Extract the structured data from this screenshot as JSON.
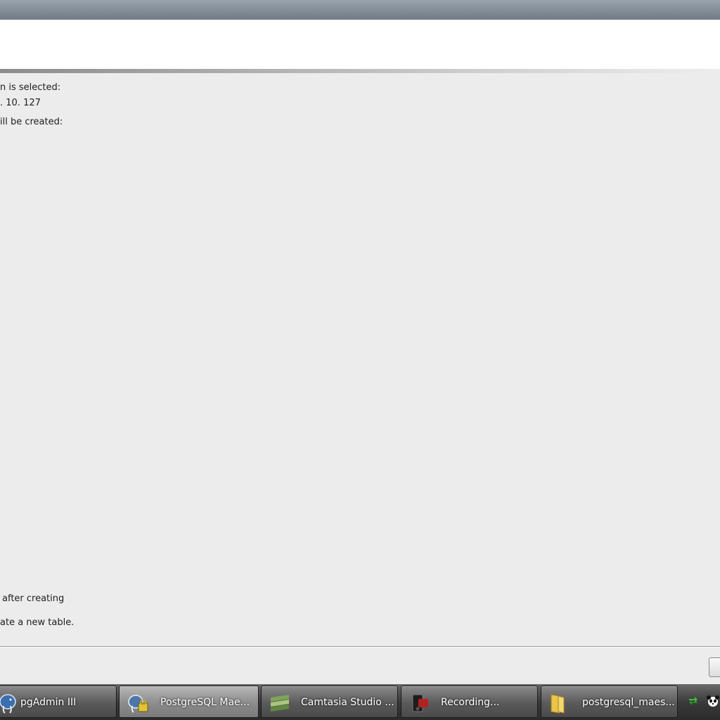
{
  "dialog": {
    "line1": "n is selected:",
    "line2": ". 10. 127",
    "line3": "ill be created:",
    "line4": "after creating",
    "line5": "ate a new table."
  },
  "taskbar": {
    "items": [
      {
        "label": "pgAdmin III",
        "icon": "elephant-icon"
      },
      {
        "label": "PostgreSQL Mae...",
        "icon": "postgres-maestro-icon"
      },
      {
        "label": "Camtasia Studio ...",
        "icon": "camtasia-icon"
      },
      {
        "label": "Recording...",
        "icon": "recorder-icon"
      },
      {
        "label": "postgresql_maes...",
        "icon": "folder-icon"
      }
    ]
  }
}
